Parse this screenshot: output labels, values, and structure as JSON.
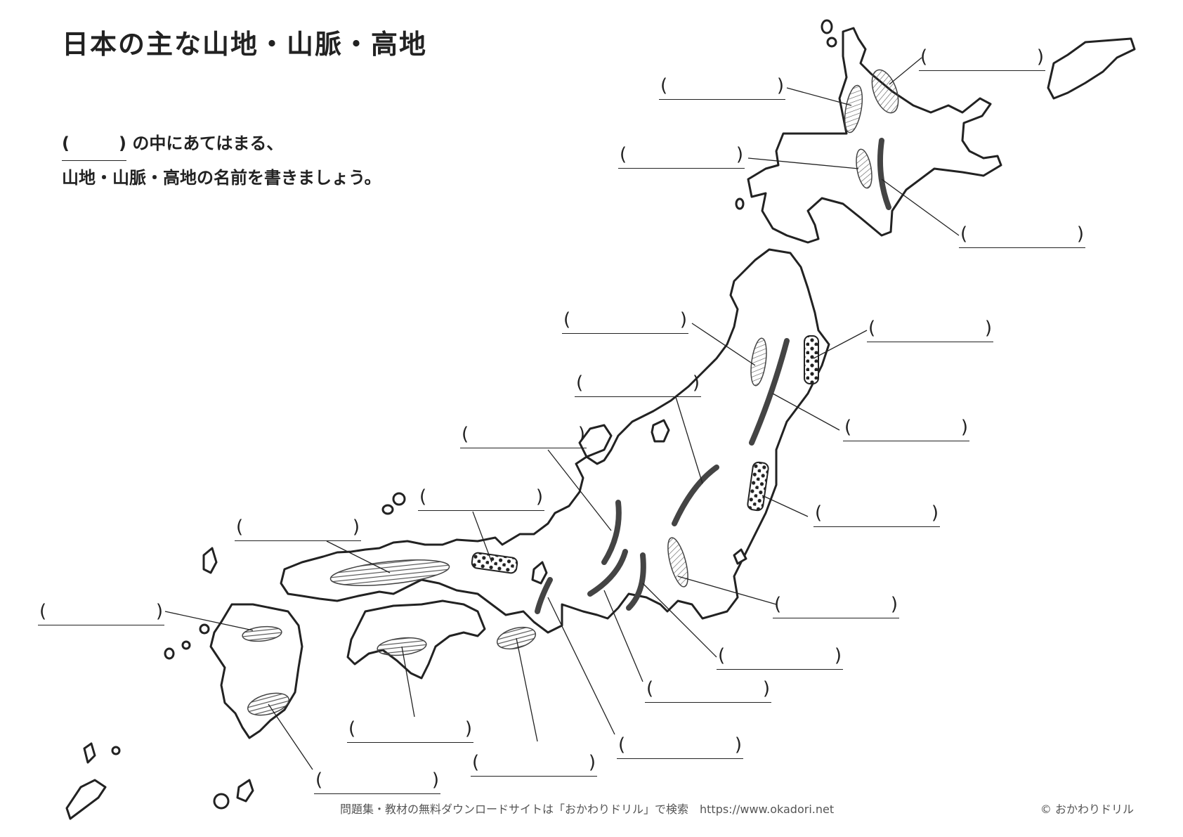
{
  "title": "日本の主な山地・山脈・高地",
  "instructions": {
    "paren_open": "(",
    "paren_close": ")",
    "line1": "の中にあてはまる、",
    "line2": "山地・山脈・高地の名前を書きましょう。"
  },
  "blank": {
    "open": "(",
    "close": ")"
  },
  "footer": {
    "text": "問題集・教材の無料ダウンロードサイトは「おかわりドリル」で検索　https://www.okadori.net",
    "copyright": "© おかわりドリル"
  }
}
